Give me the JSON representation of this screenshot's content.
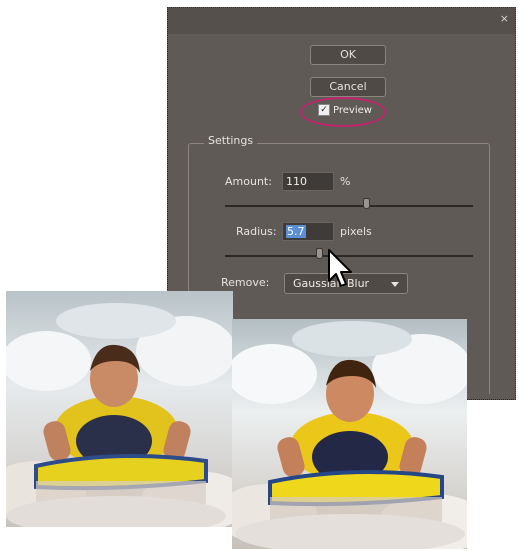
{
  "dialog": {
    "close_glyph": "×",
    "ok_label": "OK",
    "cancel_label": "Cancel",
    "preview_label": "Preview",
    "preview_checked": true,
    "settings_title": "Settings",
    "amount": {
      "label": "Amount:",
      "value": "110",
      "unit": "%",
      "slider_fraction": 0.57
    },
    "radius": {
      "label": "Radius:",
      "value": "5.7",
      "unit": "pixels",
      "slider_fraction": 0.38
    },
    "remove": {
      "label": "Remove:",
      "selected": "Gaussian Blur"
    }
  },
  "colors": {
    "dialog_bg": "#5f5a55",
    "highlight_ring": "#c0246a",
    "selection": "#5a8fd6"
  },
  "icons": [
    "close-icon",
    "check-icon",
    "dropdown-arrow-icon",
    "mouse-cursor-icon"
  ]
}
